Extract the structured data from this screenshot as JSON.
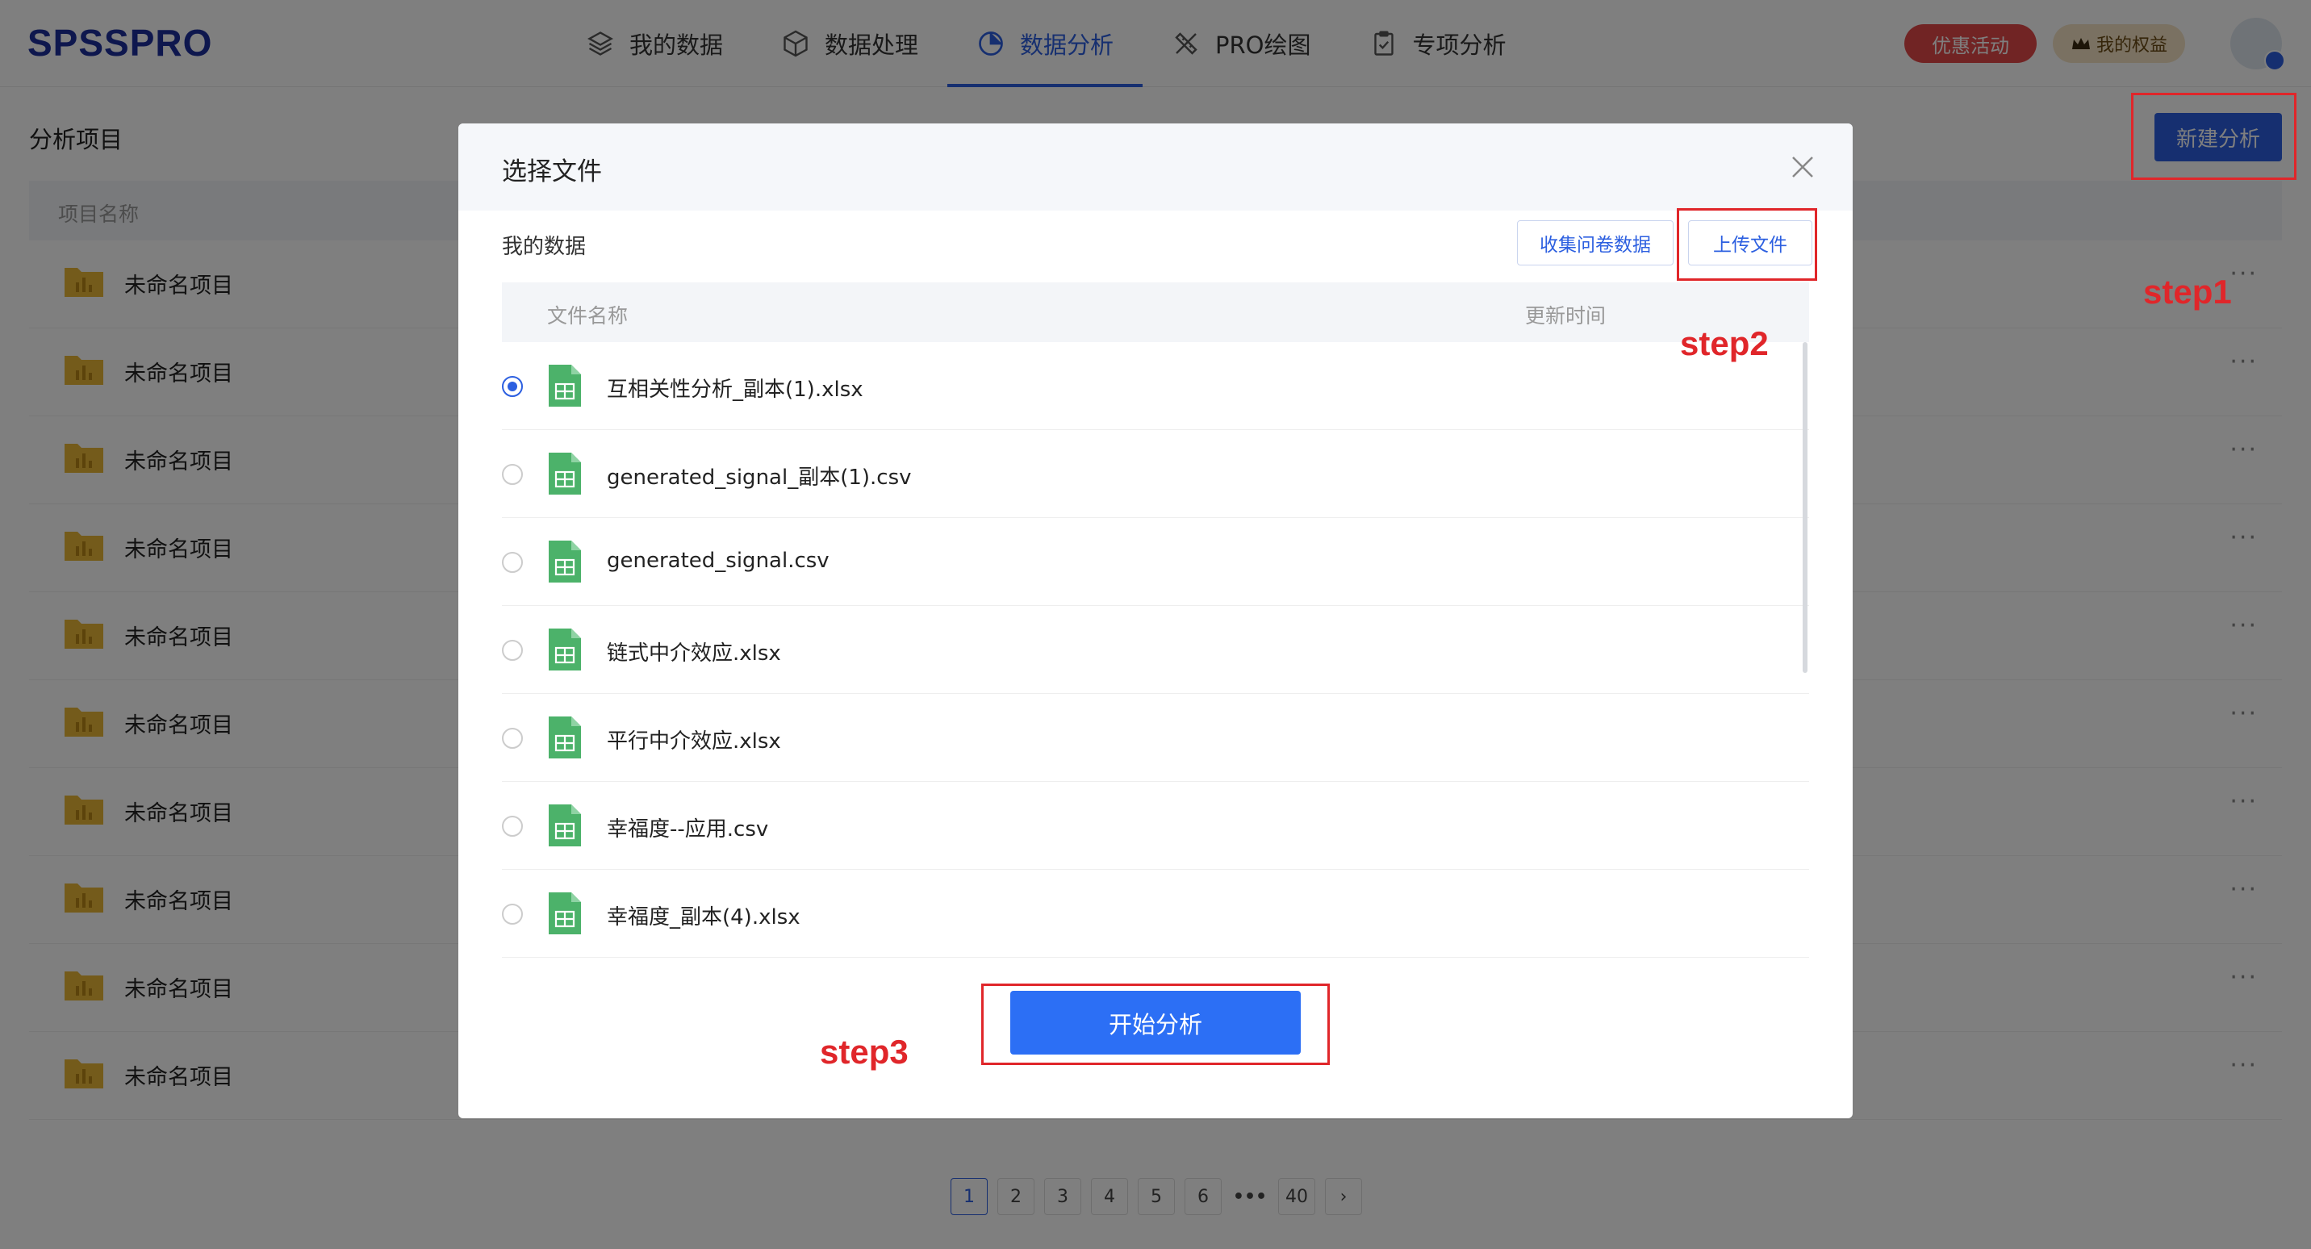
{
  "app": {
    "logo": "SPSSPRO"
  },
  "nav": [
    {
      "label": "我的数据",
      "icon": "layers-icon",
      "active": false
    },
    {
      "label": "数据处理",
      "icon": "cube-icon",
      "active": false
    },
    {
      "label": "数据分析",
      "icon": "pie-chart-icon",
      "active": true
    },
    {
      "label": "PRO绘图",
      "icon": "pen-ruler-icon",
      "active": false
    },
    {
      "label": "专项分析",
      "icon": "clipboard-icon",
      "active": false
    }
  ],
  "header_right": {
    "promo_label": "优惠活动",
    "rights_label": "我的权益"
  },
  "page": {
    "title": "分析项目",
    "new_button": "新建分析",
    "column_name": "项目名称",
    "projects": [
      "未命名项目",
      "未命名项目",
      "未命名项目",
      "未命名项目",
      "未命名项目",
      "未命名项目",
      "未命名项目",
      "未命名项目",
      "未命名项目",
      "未命名项目"
    ],
    "more_glyph": "···"
  },
  "pagination": {
    "pages": [
      "1",
      "2",
      "3",
      "4",
      "5",
      "6",
      "•••",
      "40"
    ],
    "current": "1",
    "next_glyph": "›"
  },
  "modal": {
    "title": "选择文件",
    "section_label": "我的数据",
    "survey_button": "收集问卷数据",
    "upload_button": "上传文件",
    "col_name": "文件名称",
    "col_time": "更新时间",
    "files": [
      {
        "name": "互相关性分析_副本(1).xlsx",
        "selected": true
      },
      {
        "name": "generated_signal_副本(1).csv",
        "selected": false
      },
      {
        "name": "generated_signal.csv",
        "selected": false
      },
      {
        "name": "链式中介效应.xlsx",
        "selected": false
      },
      {
        "name": "平行中介效应.xlsx",
        "selected": false
      },
      {
        "name": "幸福度--应用.csv",
        "selected": false
      },
      {
        "name": "幸福度_副本(4).xlsx",
        "selected": false
      }
    ],
    "start_button": "开始分析"
  },
  "annotations": {
    "step1": "step1",
    "step2": "step2",
    "step3": "step3",
    "color": "#e0262a"
  }
}
